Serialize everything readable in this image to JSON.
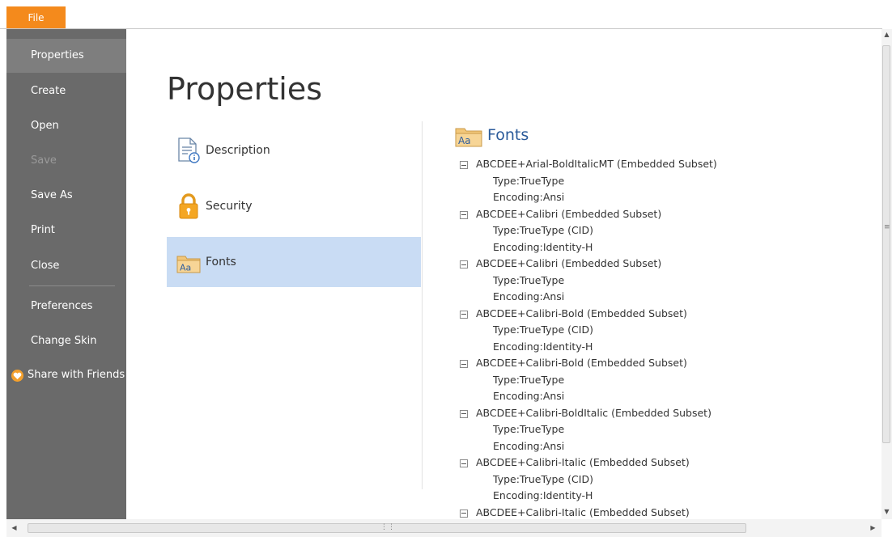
{
  "menu": {
    "file_label": "File"
  },
  "sidebar": {
    "items": [
      {
        "label": "Properties"
      },
      {
        "label": "Create"
      },
      {
        "label": "Open"
      },
      {
        "label": "Save"
      },
      {
        "label": "Save As"
      },
      {
        "label": "Print"
      },
      {
        "label": "Close"
      },
      {
        "label": "Preferences"
      },
      {
        "label": "Change Skin"
      },
      {
        "label": "Share with Friends"
      }
    ]
  },
  "main": {
    "title": "Properties",
    "nav": [
      {
        "label": "Description",
        "icon": "document-info-icon"
      },
      {
        "label": "Security",
        "icon": "lock-icon"
      },
      {
        "label": "Fonts",
        "icon": "fonts-folder-icon"
      }
    ],
    "fonts_panel": {
      "title": "Fonts",
      "fonts": [
        {
          "name": "ABCDEE+Arial-BoldItalicMT (Embedded Subset)",
          "type": "Type:TrueType",
          "encoding": "Encoding:Ansi"
        },
        {
          "name": "ABCDEE+Calibri (Embedded Subset)",
          "type": "Type:TrueType (CID)",
          "encoding": "Encoding:Identity-H"
        },
        {
          "name": "ABCDEE+Calibri (Embedded Subset)",
          "type": "Type:TrueType",
          "encoding": "Encoding:Ansi"
        },
        {
          "name": "ABCDEE+Calibri-Bold (Embedded Subset)",
          "type": "Type:TrueType (CID)",
          "encoding": "Encoding:Identity-H"
        },
        {
          "name": "ABCDEE+Calibri-Bold (Embedded Subset)",
          "type": "Type:TrueType",
          "encoding": "Encoding:Ansi"
        },
        {
          "name": "ABCDEE+Calibri-BoldItalic (Embedded Subset)",
          "type": "Type:TrueType",
          "encoding": "Encoding:Ansi"
        },
        {
          "name": "ABCDEE+Calibri-Italic (Embedded Subset)",
          "type": "Type:TrueType (CID)",
          "encoding": "Encoding:Identity-H"
        },
        {
          "name": "ABCDEE+Calibri-Italic (Embedded Subset)"
        }
      ]
    }
  },
  "colors": {
    "accent": "#f48a1c",
    "sidebar": "#6a6a6a",
    "selection": "#c9dcf4",
    "heading": "#2a5a9a"
  }
}
